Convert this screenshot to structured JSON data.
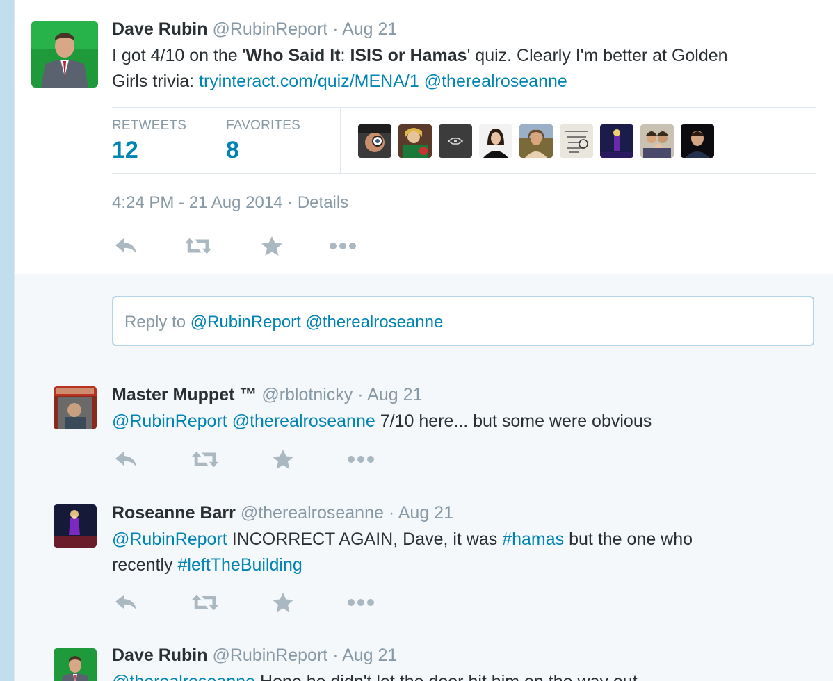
{
  "main_tweet": {
    "fullname": "Dave Rubin",
    "username": "@RubinReport",
    "sep": "·",
    "date": "Aug 21",
    "text_1": "I got 4/10 on the '",
    "bold_1": "Who Said It",
    "text_2": ": ",
    "bold_2": "ISIS or Hamas",
    "text_3": "' quiz. Clearly I'm better at Golden",
    "text_4": "Girls trivia: ",
    "link": "tryinteract.com/quiz/MENA/1",
    "mention": "@therealroseanne",
    "retweets_label": "RETWEETS",
    "retweets_count": "12",
    "favorites_label": "FAVORITES",
    "favorites_count": "8",
    "timestamp": "4:24 PM - 21 Aug 2014",
    "details_sep": " · ",
    "details": "Details"
  },
  "reply_box": {
    "prefix": "Reply to ",
    "mention_1": "@RubinReport",
    "mention_2": "@therealroseanne"
  },
  "replies": [
    {
      "fullname": "Master Muppet ™",
      "username": "@rblotnicky",
      "sep": "·",
      "date": "Aug 21",
      "mention_1": "@RubinReport",
      "mention_2": "@therealroseanne",
      "text": " 7/10 here... but some were obvious"
    },
    {
      "fullname": "Roseanne Barr",
      "username": "@therealroseanne",
      "sep": "·",
      "date": "Aug 21",
      "mention_1": "@RubinReport",
      "text_1": " INCORRECT AGAIN, Dave, it was ",
      "hashtag_1": "#hamas",
      "text_2": " but the one who",
      "text_3": "recently ",
      "hashtag_2": "#leftTheBuilding"
    },
    {
      "fullname": "Dave Rubin",
      "username": "@RubinReport",
      "sep": "·",
      "date": "Aug 21",
      "mention_1": "@therealroseanne",
      "text": " Hope he didn't let the door hit him on the way out"
    }
  ],
  "colors": {
    "link": "#0084b4",
    "muted": "#8899a6",
    "text": "#292f33",
    "page_bg": "#c0deed",
    "stream_bg": "#f5f8fa"
  },
  "icons": [
    "reply-icon",
    "retweet-icon",
    "favorite-icon",
    "more-icon"
  ]
}
